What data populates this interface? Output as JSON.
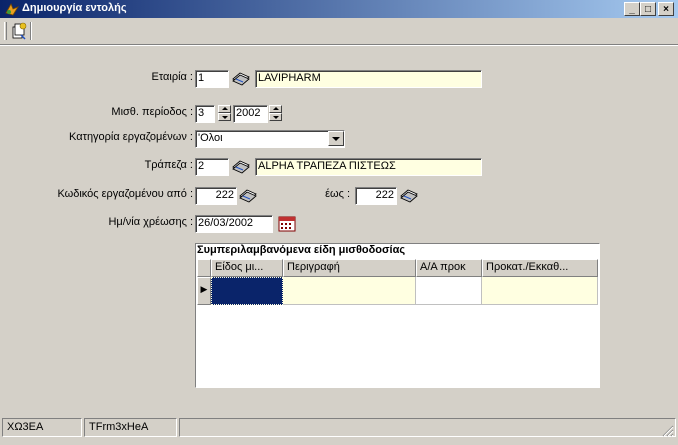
{
  "window": {
    "title": "Δημιουργία εντολής",
    "minimize_label": "_",
    "maximize_label": "□",
    "close_label": "×"
  },
  "form": {
    "company": {
      "label": "Εταιρία :",
      "code": "1",
      "name": "LAVIPHARM"
    },
    "pay_period": {
      "label": "Μισθ. περίοδος :",
      "month": "3",
      "year": "2002"
    },
    "employee_category": {
      "label": "Κατηγορία εργαζομένων :",
      "value": "'Ολοι"
    },
    "bank": {
      "label": "Τράπεζα :",
      "code": "2",
      "name": "ALPHA ΤΡΑΠΕΖΑ ΠΙΣΤΕΩΣ"
    },
    "employee_code_from": {
      "label": "Κωδικός εργαζομένου από :",
      "value": "222"
    },
    "employee_code_to": {
      "label": "έως :",
      "value": "222"
    },
    "charge_date": {
      "label": "Ημ/νία χρέωσης :",
      "value": "26/03/2002"
    }
  },
  "grid": {
    "caption": "Συμπεριλαμβανόμενα είδη μισθοδοσίας",
    "columns": [
      "Είδος μι...",
      "Περιγραφή",
      "Α/Α προκ",
      "Προκατ./Εκκαθ..."
    ],
    "row_indicator": "▶"
  },
  "statusbar": {
    "panels": [
      "ΧΩ3ΕΑ",
      "TFrm3xHeA",
      ""
    ]
  }
}
